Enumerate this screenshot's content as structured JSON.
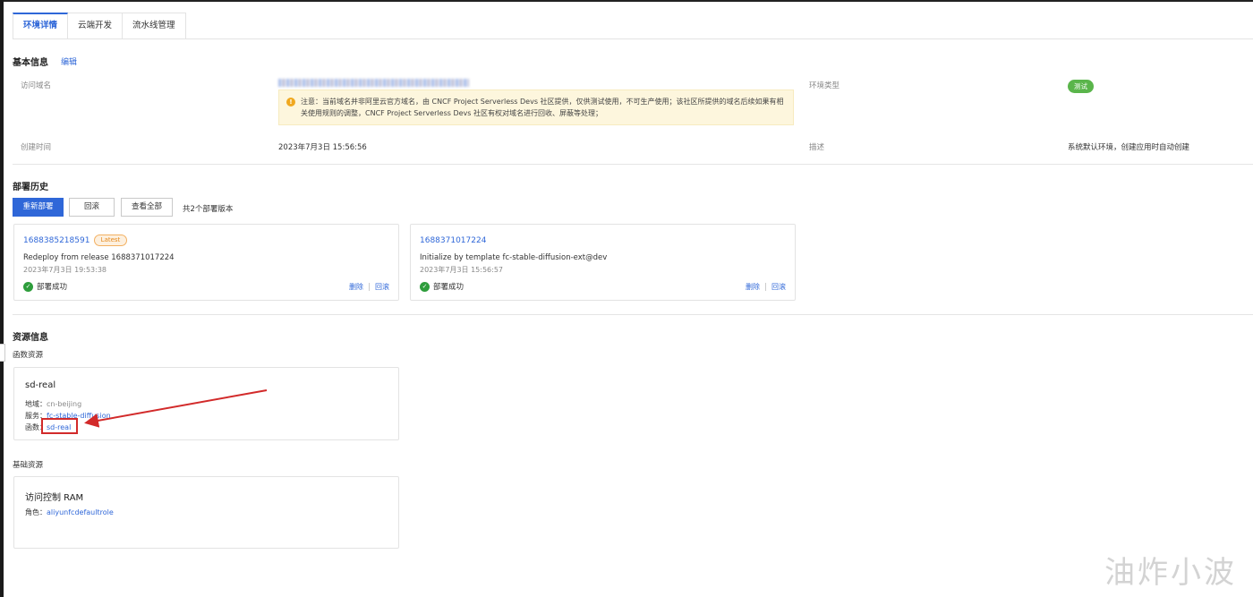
{
  "tabs": [
    {
      "label": "环境详情",
      "active": true
    },
    {
      "label": "云端开发",
      "active": false
    },
    {
      "label": "流水线管理",
      "active": false
    }
  ],
  "basic_info": {
    "title": "基本信息",
    "edit_label": "编辑",
    "domain_label": "访问域名",
    "notice": "注意：当前域名并非阿里云官方域名，由 CNCF Project Serverless Devs 社区提供，仅供测试使用，不可生产使用；该社区所提供的域名后续如果有相关使用规则的调整，CNCF Project Serverless Devs 社区有权对域名进行回收、屏蔽等处理；",
    "env_type_label": "环境类型",
    "env_type_value": "测试",
    "created_label": "创建时间",
    "created_value": "2023年7月3日 15:56:56",
    "desc_label": "描述",
    "desc_value": "系统默认环境，创建应用时自动创建"
  },
  "deploy_history": {
    "title": "部署历史",
    "redeploy_label": "重新部署",
    "rollback_label": "回滚",
    "view_all_label": "查看全部",
    "count_text": "共2个部署版本",
    "cards": [
      {
        "id": "1688385218591",
        "badge": "Latest",
        "desc": "Redeploy from release 1688371017224",
        "time": "2023年7月3日 19:53:38",
        "status": "部署成功",
        "delete": "删除",
        "rollback": "回滚"
      },
      {
        "id": "1688371017224",
        "desc": "Initialize by template fc-stable-diffusion-ext@dev",
        "time": "2023年7月3日 15:56:57",
        "status": "部署成功",
        "delete": "删除",
        "rollback": "回滚"
      }
    ]
  },
  "resources": {
    "title": "资源信息",
    "function_section": "函数资源",
    "function_card": {
      "name": "sd-real",
      "region_label": "地域：",
      "region_value": "cn-beijing",
      "service_label": "服务：",
      "service_value": "fc-stable-diffusion",
      "function_label": "函数：",
      "function_value": "sd-real"
    },
    "base_section": "基础资源",
    "ram_card": {
      "name": "访问控制 RAM",
      "role_label": "角色：",
      "role_value": "aliyunfcdefaultrole"
    }
  },
  "watermark": "油炸小波",
  "colors": {
    "accent": "#2f67d8",
    "success": "#2e9d3c",
    "annotation": "#d22a2a",
    "warning_bg": "#fdf6dd"
  }
}
